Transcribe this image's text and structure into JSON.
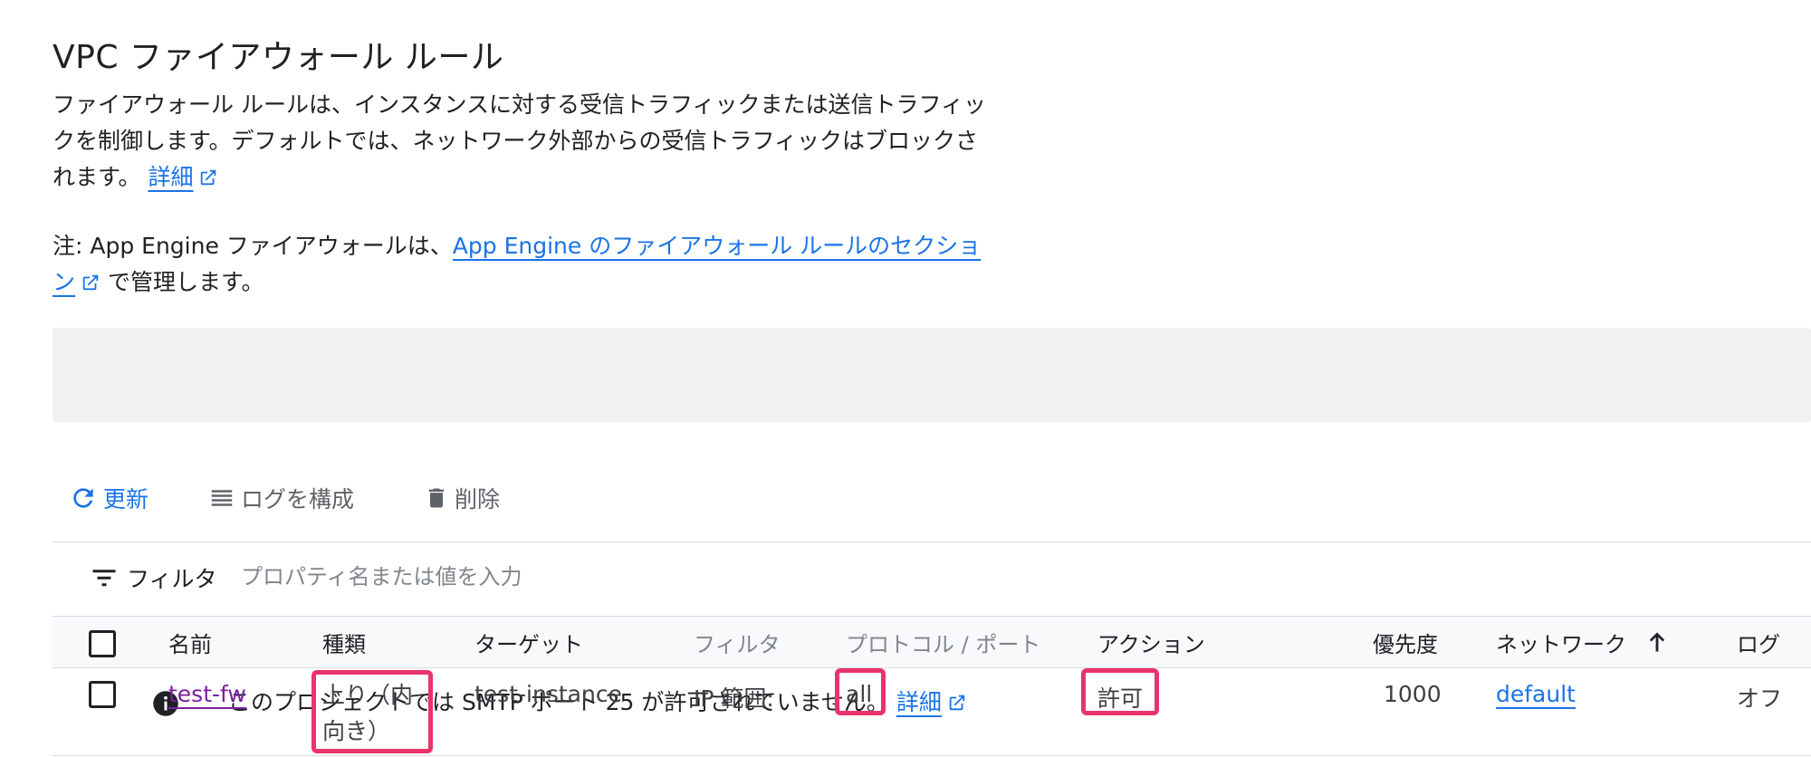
{
  "page": {
    "title": "VPC ファイアウォール ルール",
    "description_text": "ファイアウォール ルールは、インスタンスに対する受信トラフィックまたは送信トラフィックを制御します。デフォルトでは、ネットワーク外部からの受信トラフィックはブロックされます。",
    "description_link": "詳細",
    "note_prefix": "注: App Engine ファイアウォールは、",
    "note_link": "App Engine のファイアウォール ルールのセクション",
    "note_suffix": "で管理します。"
  },
  "banner": {
    "text": "このプロジェクトでは SMTP ポート 25 が許可されていません。",
    "link": "詳細",
    "icon": "info-icon"
  },
  "toolbar": {
    "refresh_label": "更新",
    "configure_logs_label": "ログを構成",
    "delete_label": "削除"
  },
  "filter": {
    "label": "フィルタ",
    "placeholder": "プロパティ名または値を入力"
  },
  "table": {
    "headers": {
      "name": "名前",
      "type": "種類",
      "target": "ターゲット",
      "filter": "フィルタ",
      "protocol_port": "プロトコル / ポート",
      "action": "アクション",
      "priority": "優先度",
      "network": "ネットワーク",
      "logs": "ログ"
    },
    "sort": {
      "column": "network",
      "direction": "ascending"
    },
    "rows": [
      {
        "name": "test-fw",
        "type": "上り（内向き）",
        "target": "test-instance",
        "filter": "IP 範囲:",
        "protocol_port": "all",
        "action": "許可",
        "priority": "1000",
        "network": "default",
        "logs": "オフ"
      }
    ]
  },
  "colors": {
    "link": "#1a73e8",
    "visited_link": "#7b1fa2",
    "highlight": "#e8336b",
    "banner_bg": "#f1f1f1"
  }
}
